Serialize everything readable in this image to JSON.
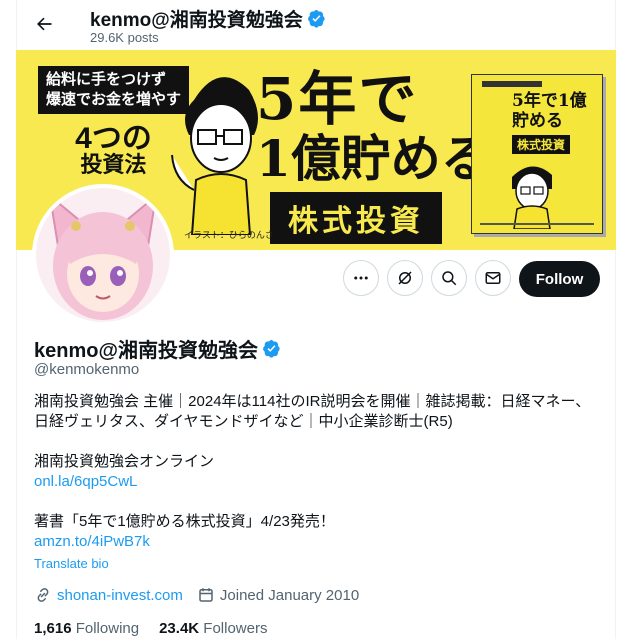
{
  "header": {
    "name": "kenmo@湘南投資勉強会",
    "posts": "29.6K posts"
  },
  "banner": {
    "tagline_1": "給料に手をつけず",
    "tagline_2": "爆速でお金を増やす",
    "method_1": "4つの",
    "method_2": "投資法",
    "title_1": "5年で",
    "title_2": "1億貯める",
    "subtitle": "株式投資",
    "credit": "イラスト：ひらのんさ",
    "book_title": "5年で1億貯める",
    "book_sub": "株式投資"
  },
  "actions": {
    "follow_label": "Follow"
  },
  "profile": {
    "name": "kenmo@湘南投資勉強会",
    "handle": "@kenmokenmo",
    "bio_line_1": "湘南投資勉強会 主催｜2024年は114社のIR説明会を開催｜雑誌掲載：日経マネー、",
    "bio_line_2": "日経ヴェリタス、ダイヤモンドザイなど｜中小企業診断士(R5)",
    "bio_line_3": "湘南投資勉強会オンライン",
    "bio_link_1": "onl.la/6qp5CwL",
    "bio_line_4": "著書「5年で1億貯める株式投資」4/23発売！",
    "bio_link_2": "amzn.to/4iPwB7k",
    "translate": "Translate bio",
    "website": "shonan-invest.com",
    "joined": "Joined January 2010",
    "following_count": "1,616",
    "following_label": "Following",
    "followers_count": "23.4K",
    "followers_label": "Followers"
  },
  "colors": {
    "accent": "#1d9bf0",
    "banner_bg": "#f7e94f",
    "text": "#0f1419",
    "muted": "#536471"
  }
}
